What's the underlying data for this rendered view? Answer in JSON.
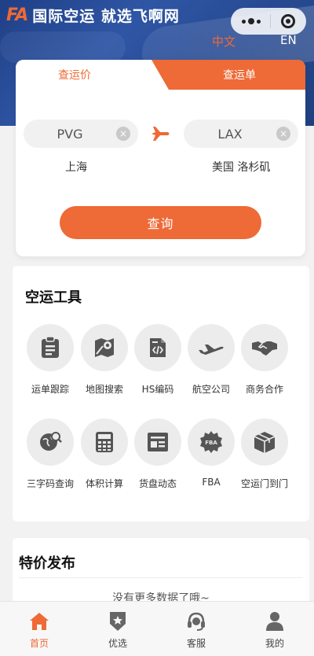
{
  "header": {
    "logo_text": "FA",
    "title": "国际空运 就选飞啊网",
    "lang_zh": "中文",
    "lang_en": "EN"
  },
  "search": {
    "tab_active": "查运价",
    "tab_inactive": "查运单",
    "origin_code": "PVG",
    "dest_code": "LAX",
    "origin_city": "上海",
    "dest_city": "美国 洛杉矶",
    "clear_glyph": "×",
    "query_label": "查询"
  },
  "tools": {
    "title": "空运工具",
    "items": [
      {
        "label": "运单跟踪",
        "icon": "clipboard-icon"
      },
      {
        "label": "地图搜索",
        "icon": "map-icon"
      },
      {
        "label": "HS编码",
        "icon": "code-file-icon"
      },
      {
        "label": "航空公司",
        "icon": "airplane-icon"
      },
      {
        "label": "商务合作",
        "icon": "handshake-icon"
      },
      {
        "label": "三字码查询",
        "icon": "globe-search-icon"
      },
      {
        "label": "体积计算",
        "icon": "calculator-icon"
      },
      {
        "label": "货盘动态",
        "icon": "receipt-icon"
      },
      {
        "label": "FBA",
        "icon": "fba-gear-icon"
      },
      {
        "label": "空运门到门",
        "icon": "box-icon"
      }
    ]
  },
  "specials": {
    "title": "特价发布",
    "empty_text": "没有更多数据了哦~"
  },
  "nav": {
    "items": [
      {
        "label": "首页",
        "icon": "home-icon",
        "active": true
      },
      {
        "label": "优选",
        "icon": "badge-star-icon",
        "active": false
      },
      {
        "label": "客服",
        "icon": "headset-icon",
        "active": false
      },
      {
        "label": "我的",
        "icon": "user-icon",
        "active": false
      }
    ]
  },
  "colors": {
    "accent": "#ee6a36",
    "hero": "#2a4b96",
    "icon_gray": "#555555"
  }
}
